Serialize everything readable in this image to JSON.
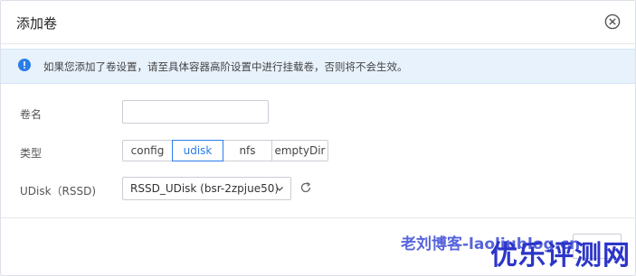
{
  "dialog": {
    "title": "添加卷"
  },
  "notice": {
    "icon": "info-icon",
    "text": "如果您添加了卷设置，请至具体容器高阶设置中进行挂载卷，否则将不会生效。",
    "color": "#2b7de9"
  },
  "form": {
    "name": {
      "label": "卷名",
      "value": "",
      "placeholder": ""
    },
    "type": {
      "label": "类型",
      "options": [
        "config",
        "udisk",
        "nfs",
        "emptyDir"
      ],
      "selected": "udisk"
    },
    "udisk": {
      "label": "UDisk（RSSD)",
      "value": "RSSD_UDisk (bsr-2zpjue50)"
    }
  },
  "watermark": {
    "text": "老刘博客-laoliublog.cn",
    "logo": "优乐评测网"
  },
  "colors": {
    "accent": "#2b7de9",
    "notice_bg": "#e8f2fd",
    "border": "#c9cdd4"
  }
}
